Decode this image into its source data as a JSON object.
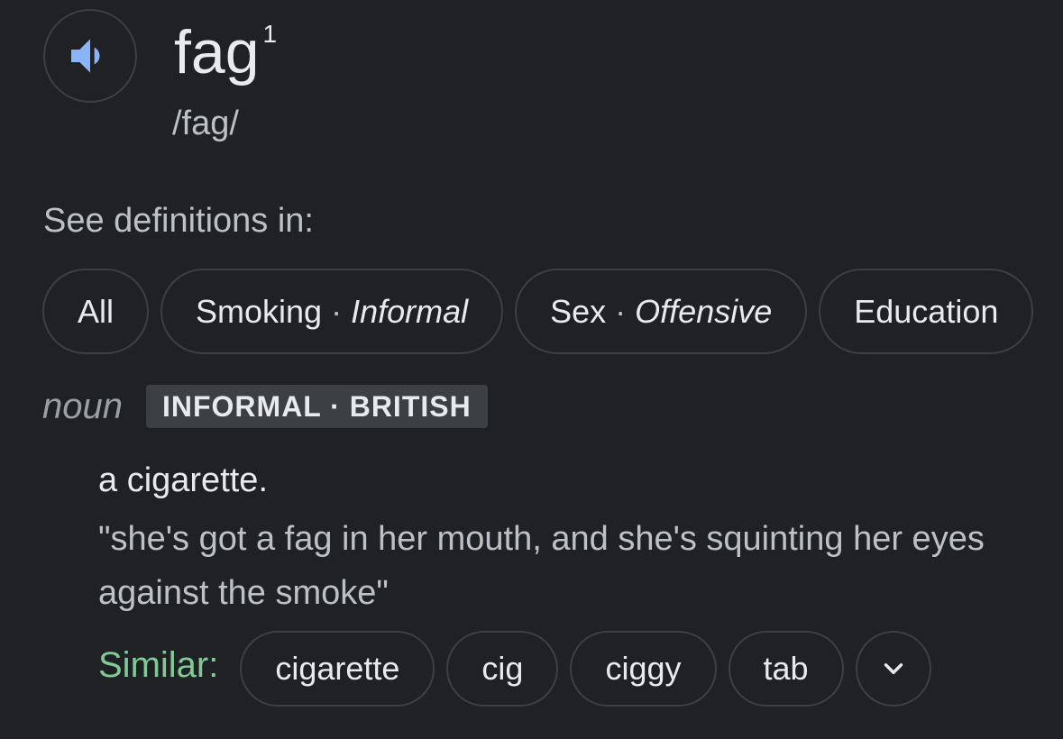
{
  "entry": {
    "word": "fag",
    "homograph_number": "1",
    "phonetic": "/fag/",
    "speaker_icon": "volume-icon",
    "speaker_color": "#8ab4f8"
  },
  "see_definitions": {
    "label": "See definitions in:",
    "chips": [
      {
        "label": "All"
      },
      {
        "label": "Smoking",
        "sep": "·",
        "qualifier": "Informal"
      },
      {
        "label": "Sex",
        "sep": "·",
        "qualifier": "Offensive"
      },
      {
        "label": "Education"
      }
    ]
  },
  "sense": {
    "part_of_speech": "noun",
    "register_label": "INFORMAL · BRITISH",
    "definition": "a cigarette.",
    "example": "\"she's got a fag in her mouth, and she's squinting her eyes against the smoke\""
  },
  "similar": {
    "label": "Similar:",
    "label_color": "#81c995",
    "words": [
      "cigarette",
      "cig",
      "ciggy",
      "tab"
    ],
    "expand_icon": "chevron-down-icon"
  }
}
